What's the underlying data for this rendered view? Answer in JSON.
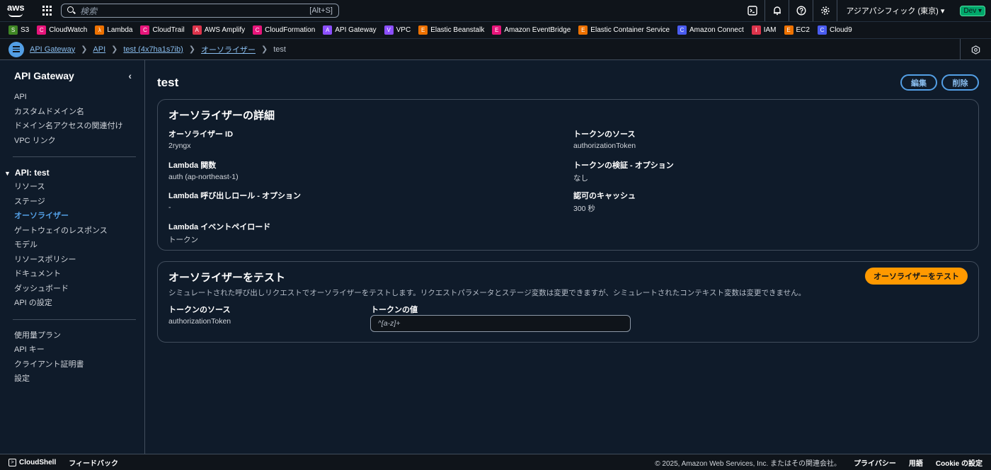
{
  "topnav": {
    "logo": "aws",
    "search_placeholder": "検索",
    "search_shortcut": "[Alt+S]",
    "region": "アジアパシフィック (東京) ▾",
    "account_badge": "Dev ▾"
  },
  "favorites": [
    {
      "label": "S3",
      "color": "#3f8624",
      "glyph": "S"
    },
    {
      "label": "CloudWatch",
      "color": "#e7157b",
      "glyph": "C"
    },
    {
      "label": "Lambda",
      "color": "#ed7100",
      "glyph": "λ"
    },
    {
      "label": "CloudTrail",
      "color": "#e7157b",
      "glyph": "C"
    },
    {
      "label": "AWS Amplify",
      "color": "#dd344c",
      "glyph": "A"
    },
    {
      "label": "CloudFormation",
      "color": "#e7157b",
      "glyph": "C"
    },
    {
      "label": "API Gateway",
      "color": "#8c4fff",
      "glyph": "A"
    },
    {
      "label": "VPC",
      "color": "#8c4fff",
      "glyph": "V"
    },
    {
      "label": "Elastic Beanstalk",
      "color": "#ed7100",
      "glyph": "E"
    },
    {
      "label": "Amazon EventBridge",
      "color": "#e7157b",
      "glyph": "E"
    },
    {
      "label": "Elastic Container Service",
      "color": "#ed7100",
      "glyph": "E"
    },
    {
      "label": "Amazon Connect",
      "color": "#4a5cf0",
      "glyph": "C"
    },
    {
      "label": "IAM",
      "color": "#dd344c",
      "glyph": "I"
    },
    {
      "label": "EC2",
      "color": "#ed7100",
      "glyph": "E"
    },
    {
      "label": "Cloud9",
      "color": "#4a5cf0",
      "glyph": "C"
    }
  ],
  "breadcrumb": {
    "items": [
      "API Gateway",
      "API",
      "test (4x7ha1s7ib)",
      "オーソライザー"
    ],
    "current": "test"
  },
  "sidebar": {
    "title": "API Gateway",
    "top_items": [
      "API",
      "カスタムドメイン名",
      "ドメイン名アクセスの関連付け",
      "VPC リンク"
    ],
    "section_title": "API: test",
    "section_items": [
      "リソース",
      "ステージ",
      "オーソライザー",
      "ゲートウェイのレスポンス",
      "モデル",
      "リソースポリシー",
      "ドキュメント",
      "ダッシュボード",
      "API の設定"
    ],
    "bottom_items": [
      "使用量プラン",
      "API キー",
      "クライアント証明書",
      "設定"
    ]
  },
  "page": {
    "title": "test",
    "edit_button": "編集",
    "delete_button": "削除"
  },
  "details": {
    "heading": "オーソライザーの詳細",
    "authorizer_id_label": "オーソライザー ID",
    "authorizer_id": "2ryngx",
    "lambda_label": "Lambda 関数",
    "lambda": "auth (ap-northeast-1)",
    "role_label": "Lambda 呼び出しロール - オプション",
    "role": "-",
    "payload_label": "Lambda イベントペイロード",
    "payload": "トークン",
    "token_source_label": "トークンのソース",
    "token_source": "authorizationToken",
    "token_validation_label": "トークンの検証 - オプション",
    "token_validation": "なし",
    "cache_label": "認可のキャッシュ",
    "cache": "300 秒"
  },
  "test": {
    "heading": "オーソライザーをテスト",
    "button": "オーソライザーをテスト",
    "description": "シミュレートされた呼び出しリクエストでオーソライザーをテストします。リクエストパラメータとステージ変数は変更できますが、シミュレートされたコンテキスト変数は変更できません。",
    "token_source_label": "トークンのソース",
    "token_source": "authorizationToken",
    "token_value_label": "トークンの値",
    "token_value_placeholder": "^[a-z]+"
  },
  "footer": {
    "cloudshell": "CloudShell",
    "feedback": "フィードバック",
    "copyright": "© 2025, Amazon Web Services, Inc. またはその関連会社。",
    "privacy": "プライバシー",
    "terms": "用語",
    "cookie": "Cookie の設定"
  }
}
